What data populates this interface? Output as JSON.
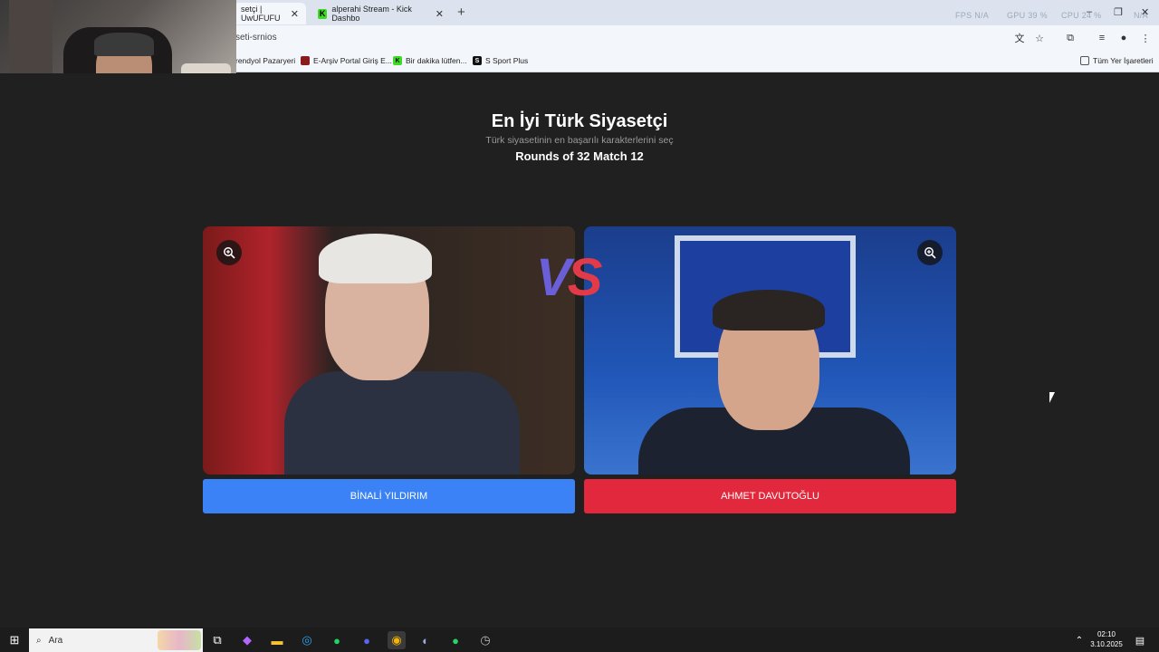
{
  "browser": {
    "tabs": [
      {
        "label": "setçi | UwUFUFU",
        "close": "✕"
      },
      {
        "label": "alperahi Stream - Kick Dashbo",
        "close": "✕"
      }
    ],
    "new_tab": "+",
    "perf_overlay": {
      "fps": "FPS  N/A",
      "gpu": "GPU  39 %",
      "cpu": "CPU  24 %",
      "other": "N/A"
    },
    "url": "seti-srnios",
    "bookmarks": [
      "rendyol Pazaryeri",
      "E-Arşiv Portal Giriş E...",
      "Bir dakika lütfen...",
      "S Sport Plus"
    ],
    "bookmarks_folder": "Tüm Yer İşaretleri"
  },
  "page": {
    "title": "En İyi Türk Siyasetçi",
    "subtitle": "Türk siyasetinin en başarılı karakterlerini seç",
    "round": "Rounds of 32 Match 12",
    "vs": {
      "v": "V",
      "s": "S"
    },
    "left_choice": "BİNALİ YILDIRIM",
    "right_choice": "AHMET DAVUTOĞLU",
    "colors": {
      "left": "#3b82f6",
      "right": "#e1283c",
      "background": "#202020"
    }
  },
  "taskbar": {
    "search_placeholder": "Ara",
    "time": "02:10",
    "date": "3.10.2025"
  }
}
